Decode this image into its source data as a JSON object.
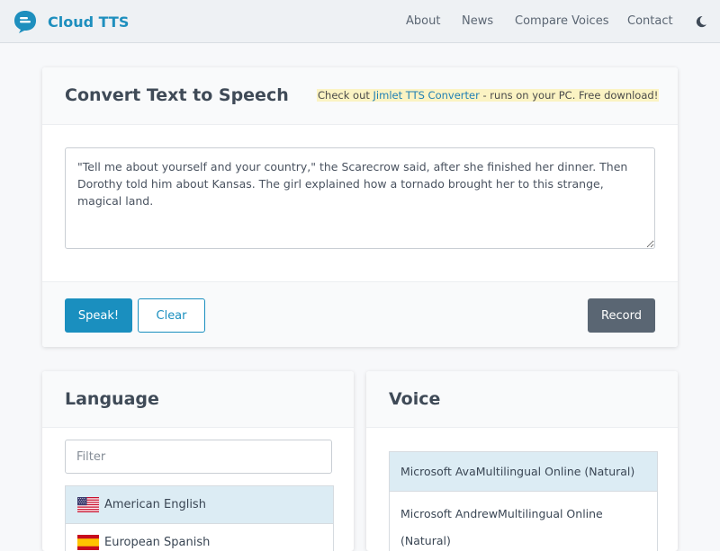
{
  "navbar": {
    "brand": "Cloud TTS",
    "links": [
      "About",
      "News",
      "Compare Voices",
      "Contact"
    ],
    "theme_icon": "moon-icon"
  },
  "converter": {
    "title": "Convert Text to Speech",
    "promo_prefix": "Check out ",
    "promo_link": "Jimlet TTS Converter",
    "promo_suffix": " - runs on your PC. Free download!",
    "text": "\"Tell me about yourself and your country,\" the Scarecrow said, after she finished her dinner. Then Dorothy told him about Kansas. The girl explained how a tornado brought her to this strange, magical land.",
    "speak_label": "Speak!",
    "clear_label": "Clear",
    "record_label": "Record"
  },
  "language": {
    "title": "Language",
    "filter_placeholder": "Filter",
    "items": [
      {
        "label": "American English",
        "flag": "us-flag",
        "selected": true
      },
      {
        "label": "European Spanish",
        "flag": "es-flag",
        "selected": false
      }
    ]
  },
  "voice": {
    "title": "Voice",
    "items": [
      {
        "label": "Microsoft AvaMultilingual Online (Natural)",
        "selected": true
      },
      {
        "label": "Microsoft AndrewMultilingual Online (Natural)",
        "selected": false
      }
    ]
  },
  "colors": {
    "accent": "#1a8fbf",
    "record_button": "#5a6673",
    "selected_row": "#dcecf4",
    "promo_highlight": "#fbf3c3"
  }
}
